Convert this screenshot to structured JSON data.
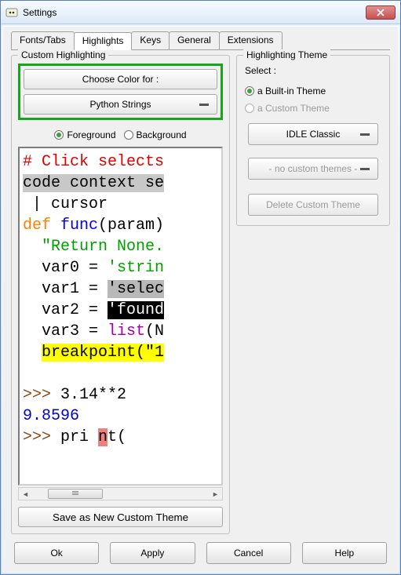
{
  "window": {
    "title": "Settings"
  },
  "tabs": [
    "Fonts/Tabs",
    "Highlights",
    "Keys",
    "General",
    "Extensions"
  ],
  "active_tab": "Highlights",
  "custom": {
    "group_title": "Custom Highlighting",
    "choose_color_label": "Choose Color for :",
    "element_dropdown": "Python Strings",
    "fg_label": "Foreground",
    "bg_label": "Background",
    "save_label": "Save as New Custom Theme"
  },
  "code": {
    "l1": "# Click selects",
    "l2": "code context se",
    "l3_bar": "|",
    "l3_rest": " cursor",
    "l4_def": "def",
    "l4_sp1": " ",
    "l4_fn": "func",
    "l4_rest": "(param)",
    "l5_ind": "  ",
    "l5_str": "\"Return None.",
    "l6_pre": "  var0 = ",
    "l6_str": "'strin",
    "l7_pre": "  var1 = ",
    "l7_sel": "'selec",
    "l8_pre": "  var2 = ",
    "l8_found": "'found",
    "l9_pre": "  var3 = ",
    "l9_list": "list",
    "l9_rest": "(N",
    "l10_ind": "  ",
    "l10_bp": "breakpoint(\"1",
    "blank": "",
    "l12_prompt": ">>>",
    "l12_rest": " 3.14**2",
    "l13": "9.8596",
    "l14_prompt": ">>>",
    "l14_pre": " pri ",
    "l14_n": "n",
    "l14_post": "t("
  },
  "theme": {
    "group_title": "Highlighting Theme",
    "select_label": "Select :",
    "builtin_label": "a Built-in Theme",
    "custom_label": "a Custom Theme",
    "builtin_dropdown": "IDLE Classic",
    "custom_dropdown": "- no custom themes -",
    "delete_label": "Delete Custom Theme"
  },
  "buttons": {
    "ok": "Ok",
    "apply": "Apply",
    "cancel": "Cancel",
    "help": "Help"
  }
}
